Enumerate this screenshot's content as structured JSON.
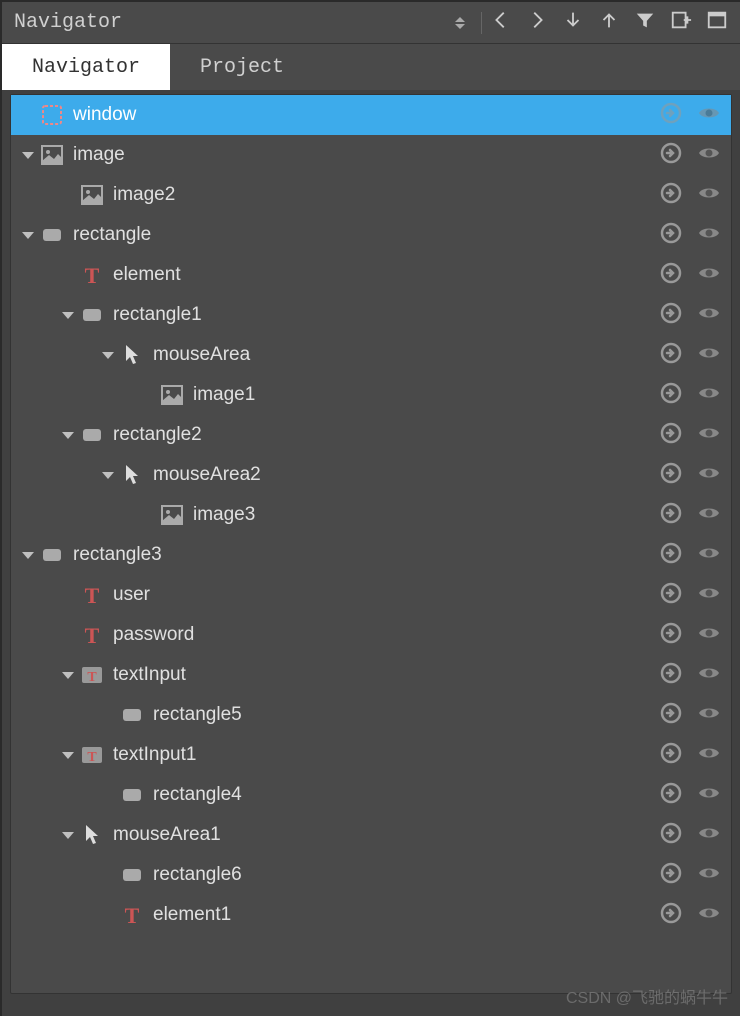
{
  "panel": {
    "title": "Navigator"
  },
  "tabs": {
    "navigator": "Navigator",
    "project": "Project"
  },
  "tree": [
    {
      "indent": 0,
      "arrow": "none",
      "icon": "window",
      "label": "window",
      "selected": true
    },
    {
      "indent": 0,
      "arrow": "expanded",
      "icon": "image",
      "label": "image"
    },
    {
      "indent": 1,
      "arrow": "none",
      "icon": "image",
      "label": "image2"
    },
    {
      "indent": 0,
      "arrow": "expanded",
      "icon": "rect",
      "label": "rectangle"
    },
    {
      "indent": 1,
      "arrow": "none",
      "icon": "text",
      "label": "element"
    },
    {
      "indent": 1,
      "arrow": "expanded",
      "icon": "rect",
      "label": "rectangle1"
    },
    {
      "indent": 2,
      "arrow": "expanded",
      "icon": "cursor",
      "label": "mouseArea"
    },
    {
      "indent": 3,
      "arrow": "none",
      "icon": "image",
      "label": "image1"
    },
    {
      "indent": 1,
      "arrow": "expanded",
      "icon": "rect",
      "label": "rectangle2"
    },
    {
      "indent": 2,
      "arrow": "expanded",
      "icon": "cursor",
      "label": "mouseArea2"
    },
    {
      "indent": 3,
      "arrow": "none",
      "icon": "image",
      "label": "image3"
    },
    {
      "indent": 0,
      "arrow": "expanded",
      "icon": "rect",
      "label": "rectangle3"
    },
    {
      "indent": 1,
      "arrow": "none",
      "icon": "text",
      "label": "user"
    },
    {
      "indent": 1,
      "arrow": "none",
      "icon": "text",
      "label": "password"
    },
    {
      "indent": 1,
      "arrow": "expanded",
      "icon": "textinput",
      "label": "textInput"
    },
    {
      "indent": 2,
      "arrow": "none",
      "icon": "rect",
      "label": "rectangle5"
    },
    {
      "indent": 1,
      "arrow": "expanded",
      "icon": "textinput",
      "label": "textInput1"
    },
    {
      "indent": 2,
      "arrow": "none",
      "icon": "rect",
      "label": "rectangle4"
    },
    {
      "indent": 1,
      "arrow": "expanded",
      "icon": "cursor",
      "label": "mouseArea1"
    },
    {
      "indent": 2,
      "arrow": "none",
      "icon": "rect",
      "label": "rectangle6"
    },
    {
      "indent": 2,
      "arrow": "none",
      "icon": "text",
      "label": "element1"
    }
  ],
  "watermark": "CSDN @飞驰的蜗牛牛"
}
